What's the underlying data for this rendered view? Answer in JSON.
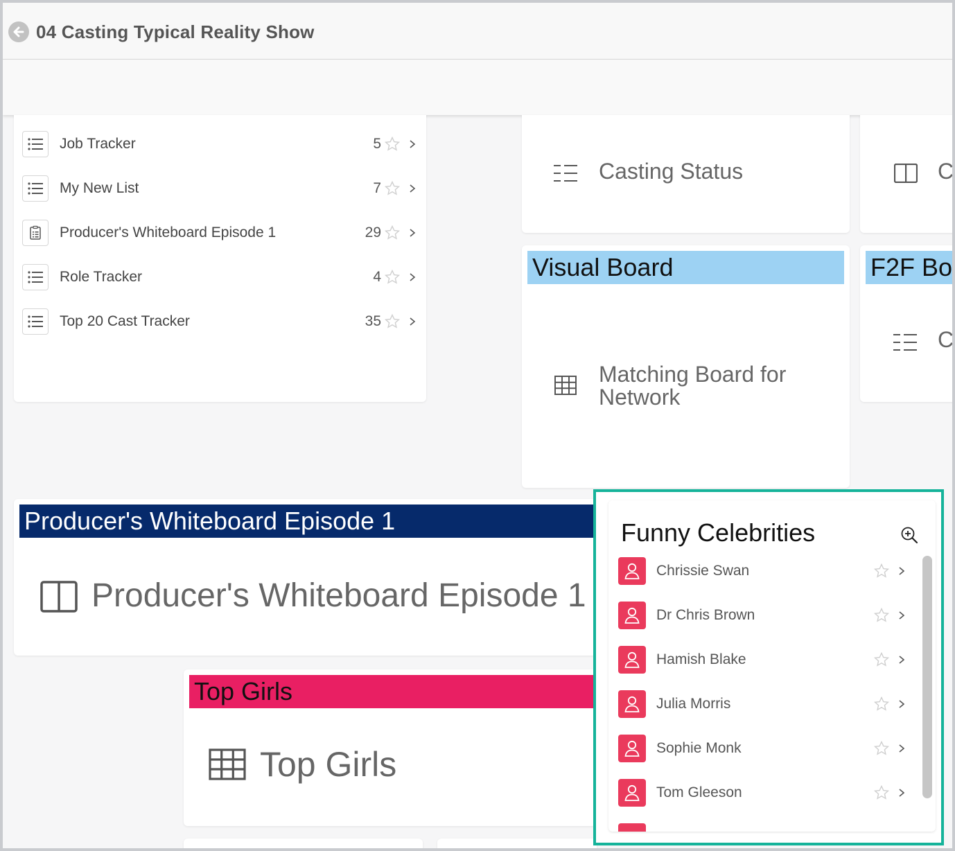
{
  "header": {
    "title": "04 Casting Typical Reality Show"
  },
  "lists": [
    {
      "label": "Job Tracker",
      "count": "5",
      "icon": "list-icon"
    },
    {
      "label": "My New List",
      "count": "7",
      "icon": "list-icon"
    },
    {
      "label": "Producer's Whiteboard Episode 1",
      "count": "29",
      "icon": "clipboard-icon"
    },
    {
      "label": "Role Tracker",
      "count": "4",
      "icon": "list-icon"
    },
    {
      "label": "Top 20 Cast Tracker",
      "count": "35",
      "icon": "list-icon"
    }
  ],
  "tiles": {
    "casting_status": {
      "label": "Casting Status"
    },
    "partial_right_top": {
      "label": "C"
    },
    "visual_board": {
      "header": "Visual Board",
      "label": "Matching Board for Network",
      "color": "#9dd2f3"
    },
    "f2f_board": {
      "header": "F2F Bo",
      "label": "C",
      "color": "#9dd2f3"
    },
    "producers_whiteboard": {
      "header": "Producer's Whiteboard Episode 1",
      "label": "Producer's Whiteboard Episode 1",
      "color": "#062a6b"
    },
    "top_girls": {
      "header": "Top Girls",
      "label": "Top Girls",
      "color": "#e91f63"
    }
  },
  "celebrities_panel": {
    "title": "Funny Celebrities",
    "accent": "#15b39a",
    "avatar_color": "#ea3a5c",
    "items": [
      "Chrissie Swan",
      "Dr Chris Brown",
      "Hamish Blake",
      "Julia Morris",
      "Sophie Monk",
      "Tom Gleeson"
    ]
  }
}
